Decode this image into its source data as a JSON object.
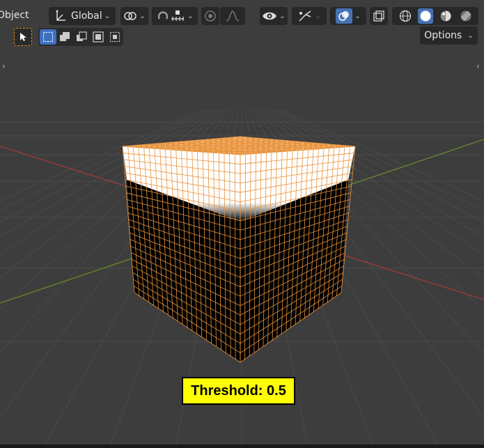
{
  "header": {
    "mode_label": "Object",
    "orientation_label": "Global",
    "options_label": "Options"
  },
  "overlay": {
    "threshold_label": "Threshold: 0.5"
  },
  "colors": {
    "viewport_bg": "#3d3d3d",
    "wire_orange": "#e8923a",
    "x_axis": "#a23a3a",
    "y_axis": "#6a8a2a",
    "threshold_bg": "#ffff00",
    "active_blue": "#4772b3"
  },
  "icons": {
    "transform_orientation": "orientation-icon",
    "pivot": "pivot-icon",
    "snap": "snap-icon",
    "snap_increment": "snap-increment-icon",
    "proportional": "proportional-editing-icon",
    "falloff": "falloff-icon",
    "visibility": "eye-icon",
    "gizmo": "gizmo-icon",
    "overlay": "overlay-icon",
    "xray": "xray-icon",
    "wireframe": "wireframe-shading-icon",
    "solid": "solid-shading-icon",
    "material": "material-shading-icon",
    "rendered": "rendered-shading-icon"
  }
}
